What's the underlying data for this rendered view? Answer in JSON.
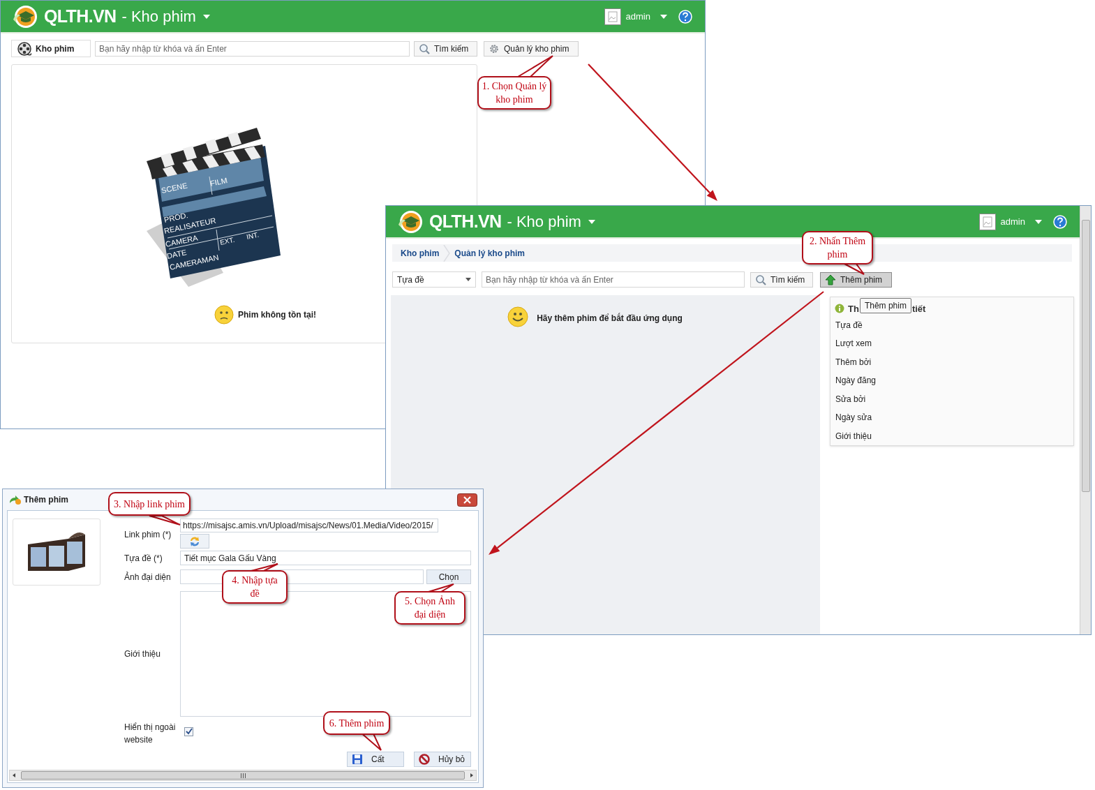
{
  "main_window": {
    "app_name": "QLTH.VN",
    "module": "- Kho phim",
    "user": "admin",
    "home_tab": "Kho phim",
    "search_placeholder": "Bạn hãy nhập từ khóa và ấn Enter",
    "search_button": "Tìm kiếm",
    "manage_button": "Quản lý kho phim",
    "clapperboard_labels": [
      "SCENE",
      "FILM",
      "PROD.",
      "REALISATEUR",
      "CAMERA",
      "EXT.",
      "INT.",
      "DATE",
      "CAMERAMAN"
    ],
    "empty_message": "Phim không tồn tại!"
  },
  "manage_window": {
    "app_name": "QLTH.VN",
    "module": "- Kho phim",
    "user": "admin",
    "breadcrumb": [
      {
        "label": "Kho phim"
      },
      {
        "label": "Quản lý kho phim"
      }
    ],
    "filter_field": "Tựa đề",
    "search_placeholder": "Bạn hãy nhập từ khóa và ấn Enter",
    "search_button": "Tìm kiếm",
    "add_button": {
      "label": "Thêm phim",
      "pressed": true
    },
    "empty_message": "Hãy thêm phim để bắt đầu ứng dụng",
    "details": {
      "title_parts": [
        "Th",
        "tiết"
      ],
      "tooltip": "Thêm phim",
      "fields": [
        "Tựa đề",
        "Lượt xem",
        "Thêm bởi",
        "Ngày đăng",
        "Sửa bởi",
        "Ngày sửa",
        "Giới thiệu"
      ]
    }
  },
  "add_dialog": {
    "title": "Thêm phim",
    "fields": [
      {
        "kind": "link",
        "label": "Link phim (*)",
        "value": "https://misajsc.amis.vn/Upload/misajsc/News/01.Media/Video/2015/"
      },
      {
        "kind": "text",
        "label": "Tựa đề (*)",
        "value": "Tiết mục Gala Gấu Vàng"
      },
      {
        "kind": "file",
        "label": "Ảnh đại diện",
        "button": "Chọn"
      },
      {
        "kind": "textarea",
        "label": "Giới thiệu"
      },
      {
        "kind": "checkbox",
        "label": "Hiển thị ngoài website",
        "checked": true
      }
    ],
    "buttons": [
      {
        "kind": "save",
        "label": "Cất"
      },
      {
        "kind": "cancel",
        "label": "Hủy bỏ"
      }
    ]
  },
  "callouts": [
    {
      "text": "1. Chọn Quản lý kho phim"
    },
    {
      "text": "2. Nhấn Thêm phim"
    },
    {
      "text": "3. Nhập link phim"
    },
    {
      "text": "4. Nhập tựa đề"
    },
    {
      "text": "5. Chọn Ảnh đại diện"
    },
    {
      "text": "6. Thêm phim"
    }
  ]
}
